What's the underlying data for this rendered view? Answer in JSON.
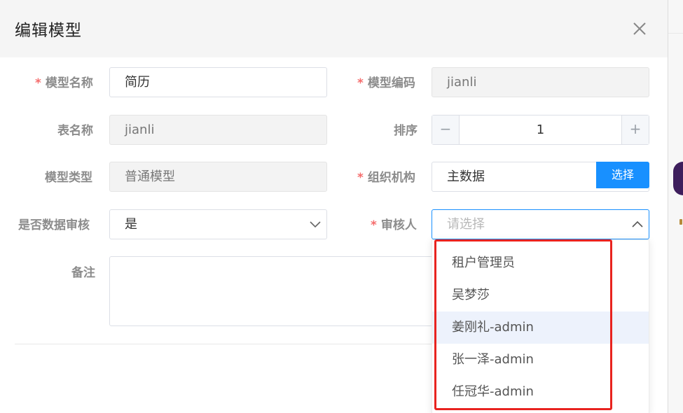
{
  "modal": {
    "title": "编辑模型"
  },
  "form": {
    "required_mark": "*",
    "model_name": {
      "label": "模型名称",
      "value": "简历"
    },
    "model_code": {
      "label": "模型编码",
      "value": "jianli"
    },
    "table_name": {
      "label": "表名称",
      "value": "jianli"
    },
    "sort": {
      "label": "排序",
      "value": "1",
      "minus": "−",
      "plus": "+"
    },
    "model_type": {
      "label": "模型类型",
      "value": "普通模型"
    },
    "organization": {
      "label": "组织机构",
      "value": "主数据",
      "select_button": "选择"
    },
    "data_review": {
      "label": "是否数据审核",
      "value": "是"
    },
    "reviewer": {
      "label": "审核人",
      "placeholder": "请选择"
    },
    "remark": {
      "label": "备注"
    }
  },
  "reviewer_dropdown": {
    "options": [
      "租户管理员",
      "吴梦莎",
      "姜刚礼-admin",
      "张一泽-admin",
      "任冠华-admin"
    ],
    "hovered_index": 2
  },
  "colors": {
    "primary": "#1890ff",
    "required": "#f56c6c",
    "highlight": "#e8231f",
    "hover_bg": "#edf2fc"
  },
  "icons": {
    "close": "close-icon",
    "chevron_down": "chevron-down-icon",
    "chevron_up": "chevron-up-icon"
  }
}
